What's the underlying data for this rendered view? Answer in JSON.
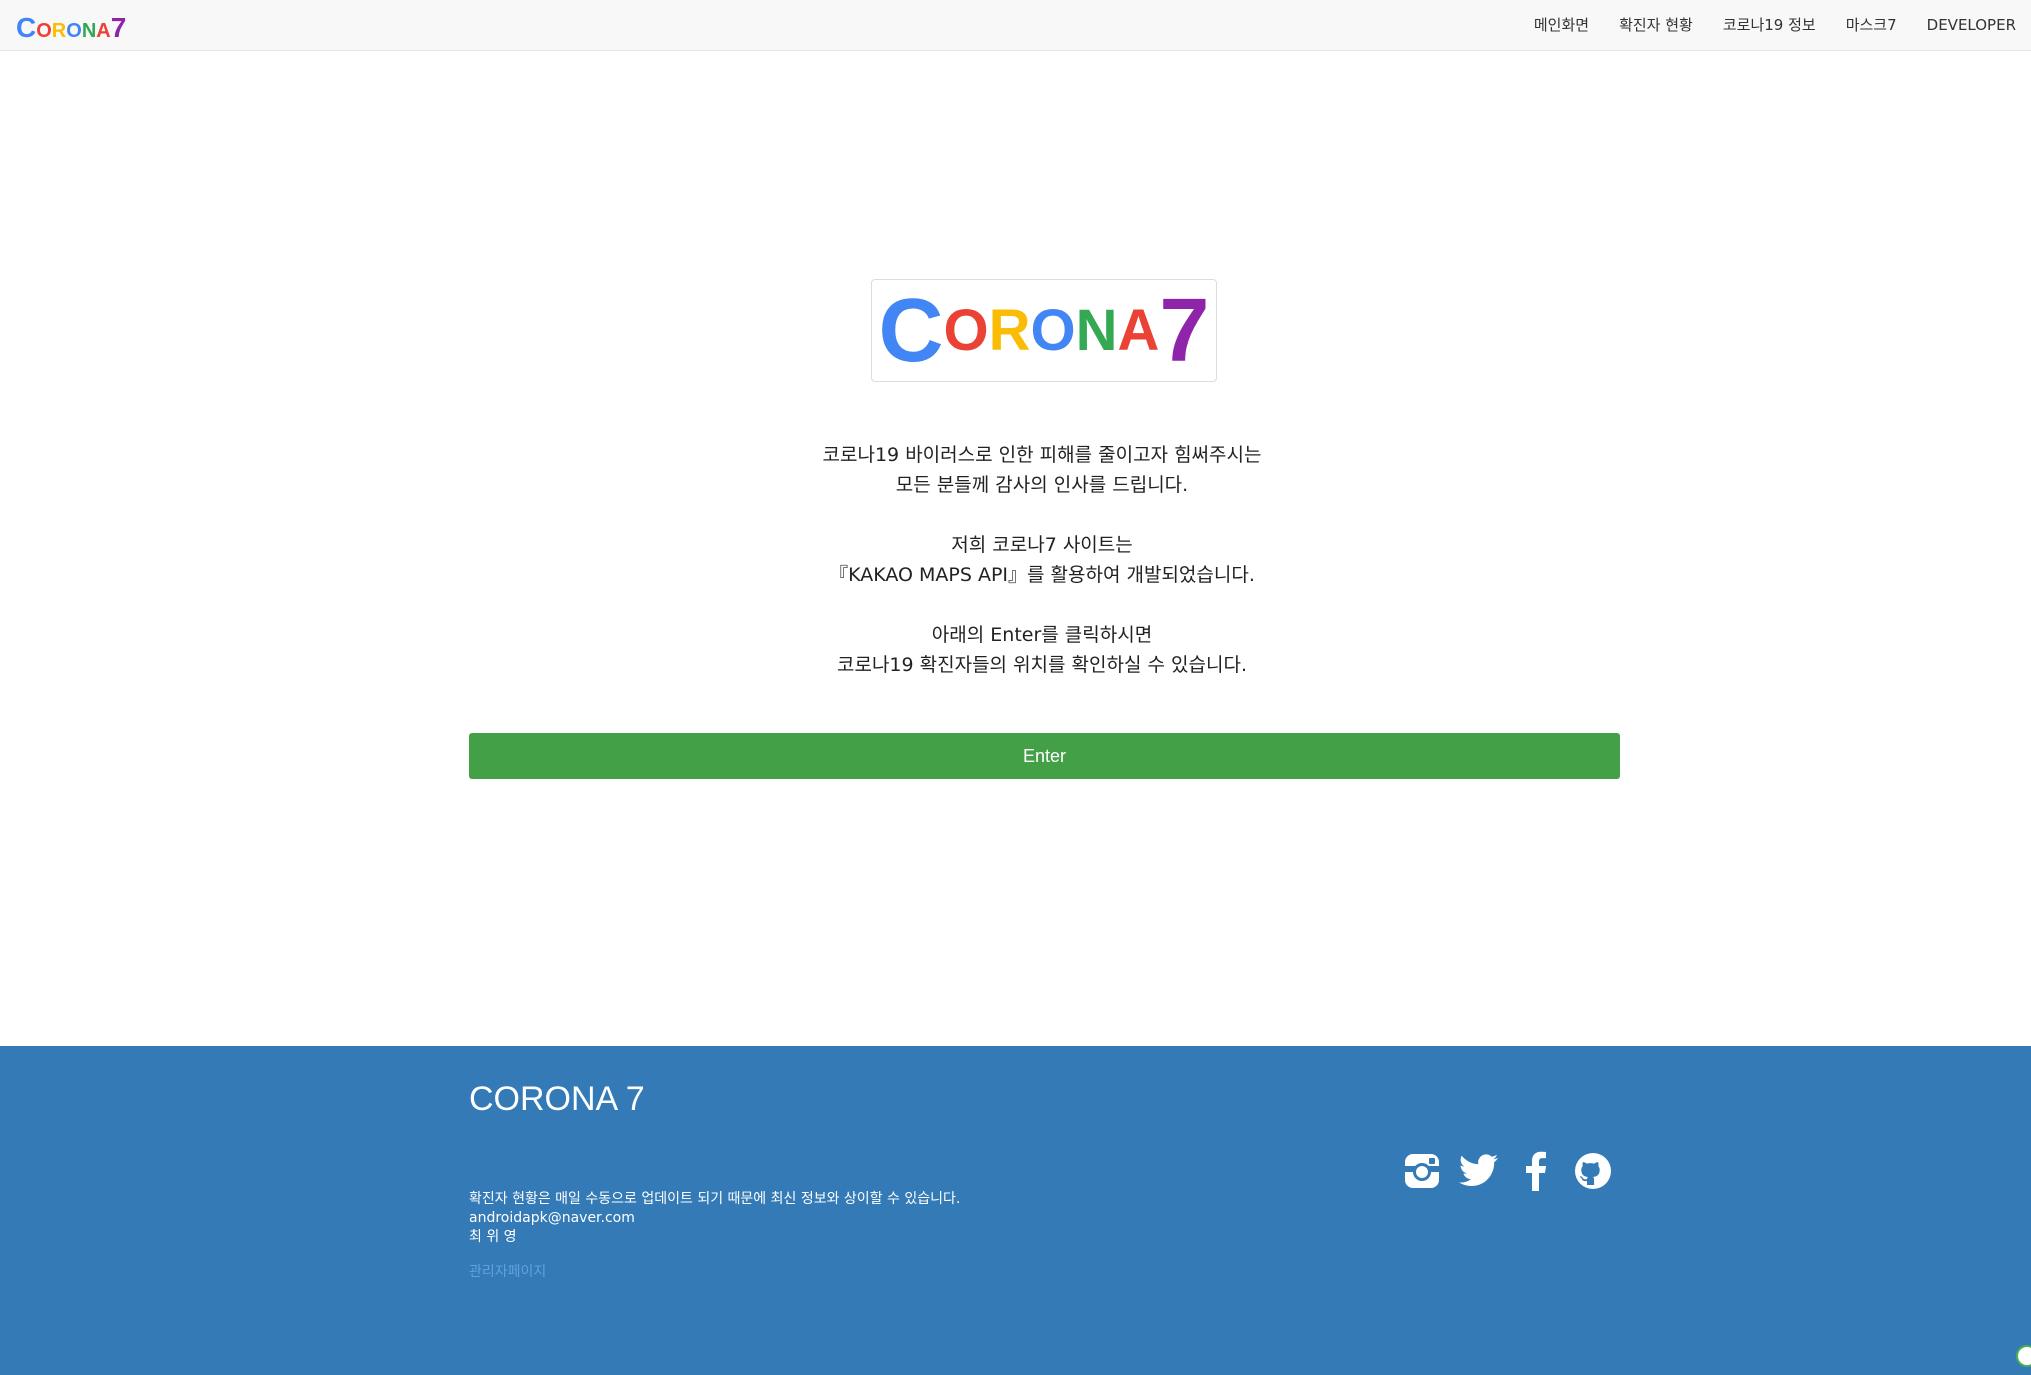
{
  "navbar": {
    "brand_letters": [
      {
        "char": "C",
        "color": "#4285f4",
        "size": "big"
      },
      {
        "char": "O",
        "color": "#ea4335",
        "size": "sm"
      },
      {
        "char": "R",
        "color": "#fbbc05",
        "size": "sm"
      },
      {
        "char": "O",
        "color": "#4285f4",
        "size": "sm"
      },
      {
        "char": "N",
        "color": "#34a853",
        "size": "sm"
      },
      {
        "char": "A",
        "color": "#ea4335",
        "size": "sm"
      },
      {
        "char": "7",
        "color": "#8e24aa",
        "size": "big"
      }
    ],
    "items": [
      {
        "label": "메인화면"
      },
      {
        "label": "확진자 현황"
      },
      {
        "label": "코로나19 정보"
      },
      {
        "label": "마스크7"
      },
      {
        "label": "DEVELOPER"
      }
    ]
  },
  "hero": {
    "paragraphs": [
      [
        "코로나19 바이러스로 인한 피해를 줄이고자 힘써주시는",
        "모든 분들께 감사의 인사를 드립니다."
      ],
      [
        "저희 코로나7 사이트는",
        "『KAKAO MAPS API』를 활용하여 개발되었습니다."
      ],
      [
        "아래의 Enter를 클릭하시면",
        "코로나19 확진자들의 위치를 확인하실 수 있습니다."
      ]
    ],
    "enter_label": "Enter"
  },
  "footer": {
    "title": "CORONA 7",
    "lines": [
      "확진자 현황은 매일 수동으로 업데이트 되기 때문에 최신 정보와 상이할 수 있습니다.",
      "androidapk@naver.com",
      "최 위 영"
    ],
    "admin_link": "관리자페이지",
    "social_icons": [
      "instagram-icon",
      "twitter-icon",
      "facebook-icon",
      "github-icon"
    ]
  },
  "colors": {
    "enter_button": "#43a047",
    "footer_bg": "#337ab7"
  }
}
